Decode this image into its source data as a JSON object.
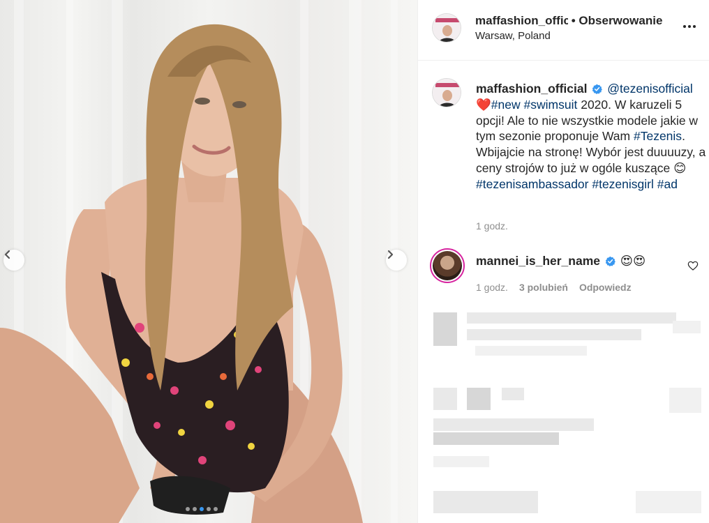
{
  "carousel": {
    "left_arrow": "‹",
    "right_arrow": "›",
    "dot_count": 5,
    "active_dot": 3
  },
  "header": {
    "username": "maffashion_official",
    "separator": "•",
    "follow_label": "Obserwowanie",
    "location": "Warsaw, Poland"
  },
  "caption": {
    "username": "maffashion_official",
    "mention": "@tezenisofficial",
    "heart_emoji": "❤️",
    "tag_new": "#new",
    "tag_swimsuit": "#swimsuit",
    "text_1": " 2020. W karuzeli 5 opcji! Ale to nie wszystkie modele jakie w tym sezonie proponuje Wam ",
    "tag_tezenis": "#Tezenis",
    "text_2": ". Wbijajcie na stronę! Wybór jest duuuuzy, a ceny strojów to już w ogóle kuszące ",
    "smile_emoji": "😊",
    "tag_ambassador": "#tezenisambassador",
    "tag_girl": "#tezenisgirl",
    "tag_ad": "#ad",
    "time": "1 godz."
  },
  "comment": {
    "username": "mannei_is_her_name",
    "text": "😍😍",
    "time": "1 godz.",
    "likes": "3 polubień",
    "reply": "Odpowiedz"
  },
  "colors": {
    "link": "#003569",
    "verified": "#3897f0",
    "meta": "#8e8e8e"
  }
}
